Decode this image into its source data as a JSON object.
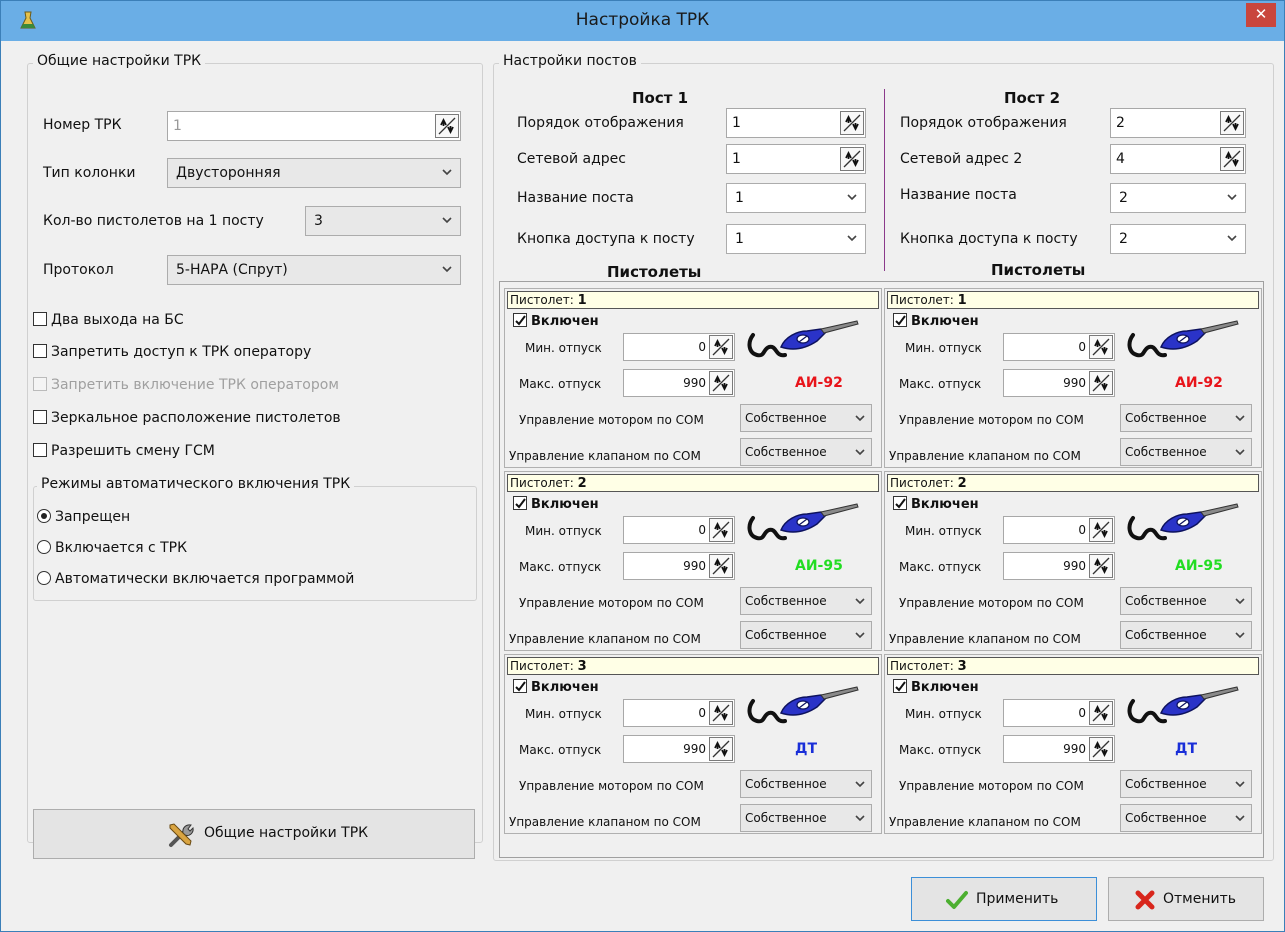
{
  "window": {
    "title": "Настройка ТРК",
    "close_label": "✕"
  },
  "general": {
    "group_title": "Общие настройки ТРК",
    "trk_number_label": "Номер ТРК",
    "trk_number_value": "1",
    "column_type_label": "Тип колонки",
    "column_type_value": "Двусторонняя",
    "guns_per_post_label": "Кол-во пистолетов на 1 посту",
    "guns_per_post_value": "3",
    "protocol_label": "Протокол",
    "protocol_value": "5-НАРА (Спрут)",
    "checkboxes": [
      {
        "label": "Два выхода на БС",
        "checked": false,
        "enabled": true
      },
      {
        "label": "Запретить доступ к ТРК оператору",
        "checked": false,
        "enabled": true
      },
      {
        "label": "Запретить включение ТРК оператором",
        "checked": false,
        "enabled": false
      },
      {
        "label": "Зеркальное расположение пистолетов",
        "checked": false,
        "enabled": true
      },
      {
        "label": "Разрешить смену ГСМ",
        "checked": false,
        "enabled": true
      }
    ],
    "auto_mode_title": "Режимы автоматического включения ТРК",
    "auto_modes": [
      {
        "label": "Запрещен",
        "selected": true
      },
      {
        "label": "Включается с ТРК",
        "selected": false
      },
      {
        "label": "Автоматически включается программой",
        "selected": false
      }
    ],
    "settings_button_label": "Общие настройки ТРК"
  },
  "posts": {
    "group_title": "Настройки постов",
    "guns_heading": "Пистолеты",
    "items": [
      {
        "title": "Пост 1",
        "order_label": "Порядок отображения",
        "order_value": "1",
        "address_label": "Сетевой адрес",
        "address_value": "1",
        "name_label": "Название поста",
        "name_value": "1",
        "access_label": "Кнопка доступа к посту",
        "access_value": "1"
      },
      {
        "title": "Пост 2",
        "order_label": "Порядок отображения",
        "order_value": "2",
        "address_label": "Сетевой адрес 2",
        "address_value": "4",
        "name_label": "Название поста",
        "name_value": "2",
        "access_label": "Кнопка доступа к посту",
        "access_value": "2"
      }
    ]
  },
  "guns_labels": {
    "gun_prefix": "Пистолет:",
    "enabled": "Включен",
    "min_label": "Мин. отпуск",
    "max_label": "Макс. отпуск",
    "motor_label": "Управление мотором по COM",
    "valve_label": "Управление клапаном по COM"
  },
  "guns": [
    [
      {
        "number": "1",
        "enabled": true,
        "min": "0",
        "max": "990",
        "fuel": "АИ-92",
        "fuel_color": "#e8141a",
        "motor": "Собственное",
        "valve": "Собственное"
      },
      {
        "number": "2",
        "enabled": true,
        "min": "0",
        "max": "990",
        "fuel": "АИ-95",
        "fuel_color": "#22dd22",
        "motor": "Собственное",
        "valve": "Собственное"
      },
      {
        "number": "3",
        "enabled": true,
        "min": "0",
        "max": "990",
        "fuel": "ДТ",
        "fuel_color": "#1a2fd8",
        "motor": "Собственное",
        "valve": "Собственное"
      }
    ],
    [
      {
        "number": "1",
        "enabled": true,
        "min": "0",
        "max": "990",
        "fuel": "АИ-92",
        "fuel_color": "#e8141a",
        "motor": "Собственное",
        "valve": "Собственное"
      },
      {
        "number": "2",
        "enabled": true,
        "min": "0",
        "max": "990",
        "fuel": "АИ-95",
        "fuel_color": "#22dd22",
        "motor": "Собственное",
        "valve": "Собственное"
      },
      {
        "number": "3",
        "enabled": true,
        "min": "0",
        "max": "990",
        "fuel": "ДТ",
        "fuel_color": "#1a2fd8",
        "motor": "Собственное",
        "valve": "Собственное"
      }
    ]
  ],
  "footer": {
    "apply_label": "Применить",
    "cancel_label": "Отменить"
  }
}
